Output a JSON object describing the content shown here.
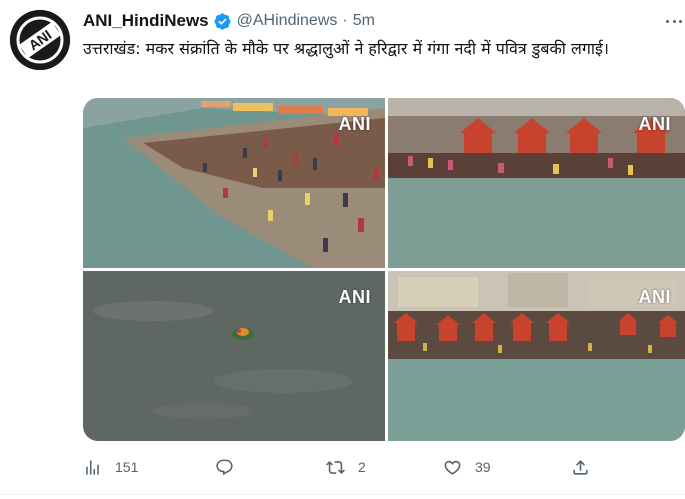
{
  "tweet": {
    "display_name": "ANI_HindiNews",
    "handle": "@AHindinews",
    "separator": "·",
    "time": "5m",
    "text": "उत्तराखंड: मकर संक्रांति के मौके पर श्रद्धालुओं ने हरिद्वार में गंगा नदी में पवित्र डुबकी लगाई।",
    "avatar_logo": "ANI",
    "verified": true,
    "brand_color": "#1d9bf0"
  },
  "media": {
    "watermark": "ANI",
    "images": [
      {
        "name": "ghat-crowd-steps"
      },
      {
        "name": "river-bathers-red-shrines"
      },
      {
        "name": "river-floating-offering"
      },
      {
        "name": "ghat-wide-view"
      }
    ]
  },
  "actions": {
    "views": {
      "icon": "views-icon",
      "count": "151"
    },
    "reply": {
      "icon": "reply-icon",
      "count": ""
    },
    "retweet": {
      "icon": "retweet-icon",
      "count": "2"
    },
    "like": {
      "icon": "like-icon",
      "count": "39"
    },
    "share": {
      "icon": "share-icon",
      "count": ""
    }
  }
}
